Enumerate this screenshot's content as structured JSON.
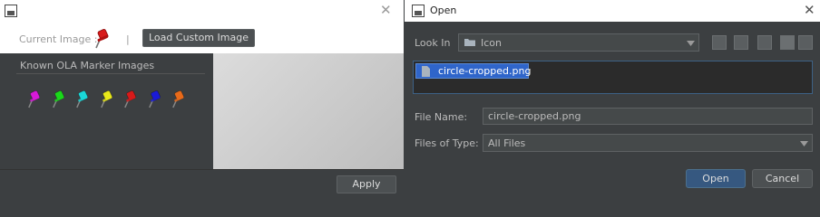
{
  "left": {
    "title": "",
    "current_image_label": "Current Image :",
    "separator": "|",
    "load_button": "Load Custom Image",
    "known_title": "Known OLA Marker Images",
    "apply_button": "Apply",
    "marker_colors": [
      "#d81ad8",
      "#1ad81a",
      "#1ad8d8",
      "#e8e81a",
      "#d81a1a",
      "#1a1ad8",
      "#e86a1a"
    ],
    "current_marker_color": "#d81a1a"
  },
  "right": {
    "title": "Open",
    "look_in_label": "Look In",
    "look_in_value": "Icon",
    "file_entry": "circle-cropped.png",
    "file_name_label": "File Name:",
    "file_name_value": "circle-cropped.png",
    "files_type_label": "Files of Type:",
    "files_type_value": "All Files",
    "open_button": "Open",
    "cancel_button": "Cancel",
    "accent": "#365880"
  }
}
